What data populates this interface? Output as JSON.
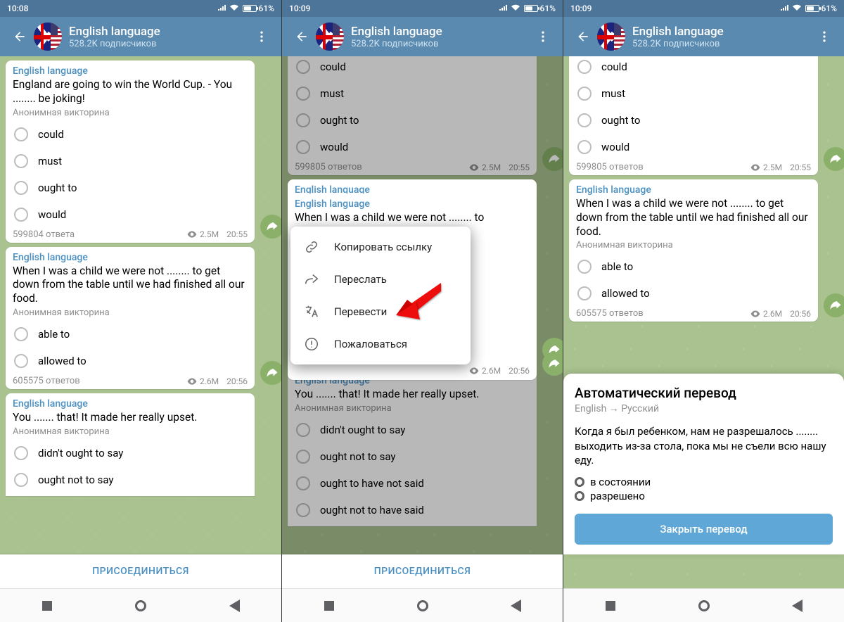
{
  "screens": [
    {
      "statusbar": {
        "time": "10:08",
        "battery": "61%"
      },
      "header": {
        "title": "English language",
        "subtitle": "528.2K подписчиков"
      },
      "join_label": "ПРИСОЕДИНИТЬСЯ",
      "messages": [
        {
          "sender": "English language",
          "question": "England are going to win the World Cup. - You ........ be joking!",
          "anon": "Анонимная викторина",
          "options": [
            "could",
            "must",
            "ought to",
            "would"
          ],
          "answers": "599804 ответа",
          "views": "2.5M",
          "time": "20:55"
        },
        {
          "sender": "English language",
          "question": "When I was a child we were not ........ to get down from the table until we had finished all our food.",
          "anon": "Анонимная викторина",
          "options": [
            "able to",
            "allowed to"
          ],
          "answers": "605575 ответов",
          "views": "2.6M",
          "time": "20:56"
        },
        {
          "sender": "English language",
          "question": "You ....... that! It made her really upset.",
          "anon": "Анонимная викторина",
          "options": [
            "didn't ought to say",
            "ought not to say"
          ]
        }
      ]
    },
    {
      "statusbar": {
        "time": "10:09",
        "battery": "61%"
      },
      "header": {
        "title": "English language",
        "subtitle": "528.2K подписчиков"
      },
      "join_label": "ПРИСОЕДИНИТЬСЯ",
      "messages_top": {
        "options": [
          "could",
          "must",
          "ought to",
          "would"
        ],
        "answers": "599805 ответов",
        "views": "2.5M",
        "time": "20:55"
      },
      "selected_message": {
        "sender": "English language",
        "question_part": "When I was a child we were not ........ to",
        "views": "2.6M",
        "time": "20:56"
      },
      "context_menu": [
        {
          "icon": "link-icon",
          "label": "Копировать ссылку"
        },
        {
          "icon": "forward-icon",
          "label": "Переслать"
        },
        {
          "icon": "translate-icon",
          "label": "Перевести"
        },
        {
          "icon": "report-icon",
          "label": "Пожаловаться"
        }
      ],
      "messages_bottom": {
        "sender": "English language",
        "question": "You ....... that! It made her really upset.",
        "anon": "Анонимная викторина",
        "options": [
          "didn't ought to say",
          "ought not to say",
          "ought to have not said",
          "ought not to have said"
        ]
      }
    },
    {
      "statusbar": {
        "time": "10:09",
        "battery": "61%"
      },
      "header": {
        "title": "English language",
        "subtitle": "528.2K подписчиков"
      },
      "messages_top": {
        "options": [
          "could",
          "must",
          "ought to",
          "would"
        ],
        "answers": "599805 ответов",
        "views": "2.5M",
        "time": "20:55"
      },
      "message_mid": {
        "sender": "English language",
        "question": "When I was a child we were not ........ to get down from the table until we had finished all our food.",
        "anon": "Анонимная викторина",
        "options": [
          "able to",
          "allowed to"
        ],
        "answers": "605575 ответов",
        "views": "2.6M",
        "time": "20:56"
      },
      "sheet": {
        "title": "Автоматический перевод",
        "lang": "English → Русский",
        "body": "Когда я был ребенком, нам не разрешалось ........ выходить из-за стола, пока мы не съели всю нашу еду.",
        "bullets": [
          "в состоянии",
          "разрешено"
        ],
        "close": "Закрыть перевод"
      }
    }
  ]
}
